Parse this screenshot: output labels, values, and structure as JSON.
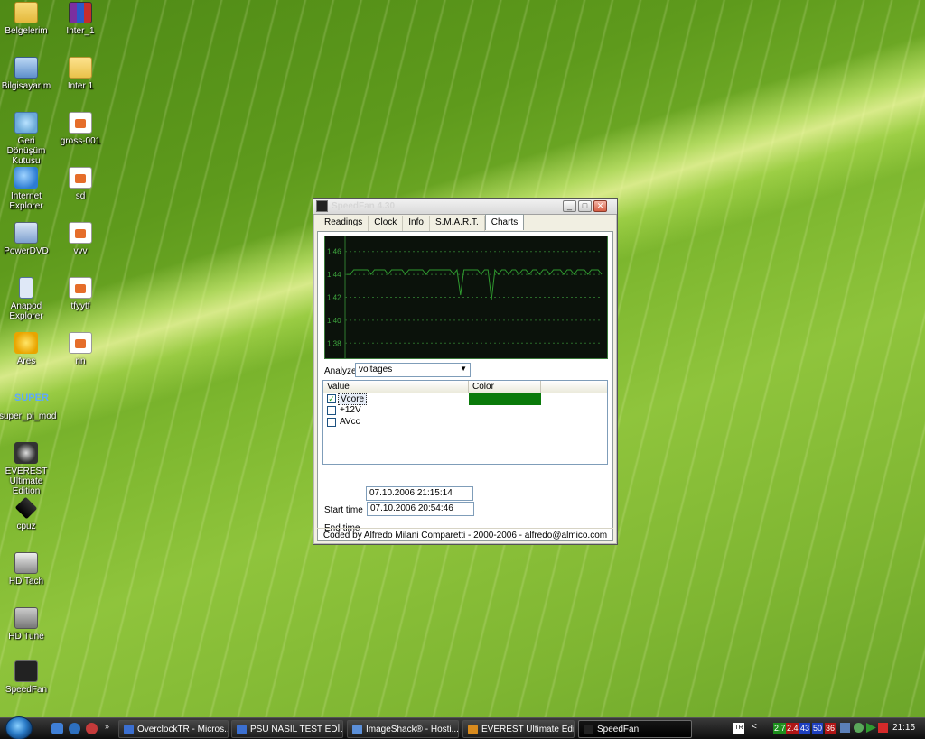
{
  "desktop": {
    "icons": [
      {
        "label": "Belgelerim",
        "icon": "documents-folder-icon"
      },
      {
        "label": "Inter_1",
        "icon": "winrar-archive-icon"
      },
      {
        "label": "Bilgisayarım",
        "icon": "computer-icon"
      },
      {
        "label": "Inter 1",
        "icon": "folder-icon"
      },
      {
        "label": "Geri Dönüşüm Kutusu",
        "icon": "recycle-bin-icon"
      },
      {
        "label": "gross-001",
        "icon": "image-file-icon"
      },
      {
        "label": "Internet Explorer",
        "icon": "internet-explorer-icon"
      },
      {
        "label": "sd",
        "icon": "image-file-icon"
      },
      {
        "label": "PowerDVD",
        "icon": "powerdvd-icon"
      },
      {
        "label": "vvv",
        "icon": "image-file-icon"
      },
      {
        "label": "Anapod Explorer",
        "icon": "anapod-icon"
      },
      {
        "label": "tfyytf",
        "icon": "image-file-icon"
      },
      {
        "label": "Ares",
        "icon": "ares-icon"
      },
      {
        "label": "nn",
        "icon": "image-file-icon"
      },
      {
        "label": "super_pi_mod",
        "icon": "super-pi-icon"
      },
      {
        "label": "EVEREST Ultimate Edition",
        "icon": "everest-icon"
      },
      {
        "label": "cpuz",
        "icon": "cpuz-icon"
      },
      {
        "label": "HD Tach",
        "icon": "hd-tach-icon"
      },
      {
        "label": "HD Tune",
        "icon": "hd-tune-icon"
      },
      {
        "label": "SpeedFan",
        "icon": "speedfan-icon"
      }
    ],
    "super_glyph": "SUPER"
  },
  "window": {
    "title": "SpeedFan 4.30",
    "controls": {
      "minimize": "_",
      "maximize": "□",
      "close": "✕"
    },
    "tabs": [
      {
        "label": "Readings",
        "active": false
      },
      {
        "label": "Clock",
        "active": false
      },
      {
        "label": "Info",
        "active": false
      },
      {
        "label": "S.M.A.R.T.",
        "active": false
      },
      {
        "label": "Charts",
        "active": true
      }
    ],
    "analyze_label": "Analyze",
    "analyze_value": "voltages",
    "list": {
      "col_value": "Value",
      "col_color": "Color",
      "rows": [
        {
          "label": "Vcore",
          "checked": true,
          "color": "#0a7a0a",
          "selected": true
        },
        {
          "label": "+12V",
          "checked": false,
          "color": ""
        },
        {
          "label": "AVcc",
          "checked": false,
          "color": ""
        }
      ]
    },
    "start_label": "Start time",
    "start_value": "07.10.2006 20:54:46",
    "end_label": "End time",
    "end_value": "07.10.2006 21:15:14",
    "footer": "Coded by Alfredo Milani Comparetti - 2000-2006 - alfredo@almico.com"
  },
  "chart_data": {
    "type": "line",
    "title": "",
    "xlabel": "",
    "ylabel": "",
    "ylim": [
      1.37,
      1.47
    ],
    "yticks": [
      "1.46",
      "1.44",
      "1.42",
      "1.40",
      "1.38"
    ],
    "ytick_values": [
      1.46,
      1.44,
      1.42,
      1.4,
      1.38
    ],
    "grid": true,
    "series": [
      {
        "color": "#2f9a2f",
        "values": [
          1.44,
          1.44,
          1.444,
          1.444,
          1.444,
          1.444,
          1.444,
          1.44,
          1.444,
          1.444,
          1.444,
          1.444,
          1.44,
          1.444,
          1.444,
          1.444,
          1.444,
          1.44,
          1.444,
          1.444,
          1.444,
          1.444,
          1.444,
          1.44,
          1.444,
          1.444,
          1.444,
          1.444,
          1.444,
          1.444,
          1.444,
          1.44,
          1.444,
          1.422,
          1.444,
          1.444,
          1.444,
          1.444,
          1.444,
          1.44,
          1.444,
          1.444,
          1.418,
          1.444,
          1.44,
          1.444,
          1.444,
          1.44,
          1.444,
          1.444,
          1.44,
          1.444,
          1.444,
          1.44,
          1.444,
          1.444,
          1.44,
          1.444,
          1.444,
          1.44,
          1.444,
          1.444,
          1.444,
          1.44,
          1.444,
          1.444,
          1.44,
          1.444,
          1.444,
          1.444,
          1.44,
          1.444,
          1.444,
          1.444,
          1.44
        ]
      }
    ]
  },
  "taskbar": {
    "quicklaunch_more": "»",
    "tasks": [
      {
        "label": "OverclockTR - Micros...",
        "icon": "word-icon",
        "active": false
      },
      {
        "label": "PSU NASIL TEST EDİL...",
        "icon": "word-icon",
        "active": false
      },
      {
        "label": "ImageShack® - Hosti...",
        "icon": "browser-icon",
        "active": false
      },
      {
        "label": "EVEREST Ultimate Edi...",
        "icon": "everest-icon",
        "active": false
      },
      {
        "label": "SpeedFan",
        "icon": "speedfan-icon",
        "active": true
      }
    ],
    "tray": {
      "lang": "TR",
      "arrow": "<",
      "numbers": [
        {
          "text": "2.7",
          "bg": "#1d8f1d"
        },
        {
          "text": "2.4",
          "bg": "#b01515"
        },
        {
          "text": "43",
          "bg": "#1d3fbf"
        },
        {
          "text": "50",
          "bg": "#1d3fbf"
        },
        {
          "text": "36",
          "bg": "#b01515"
        }
      ],
      "clock": "21:15"
    }
  }
}
